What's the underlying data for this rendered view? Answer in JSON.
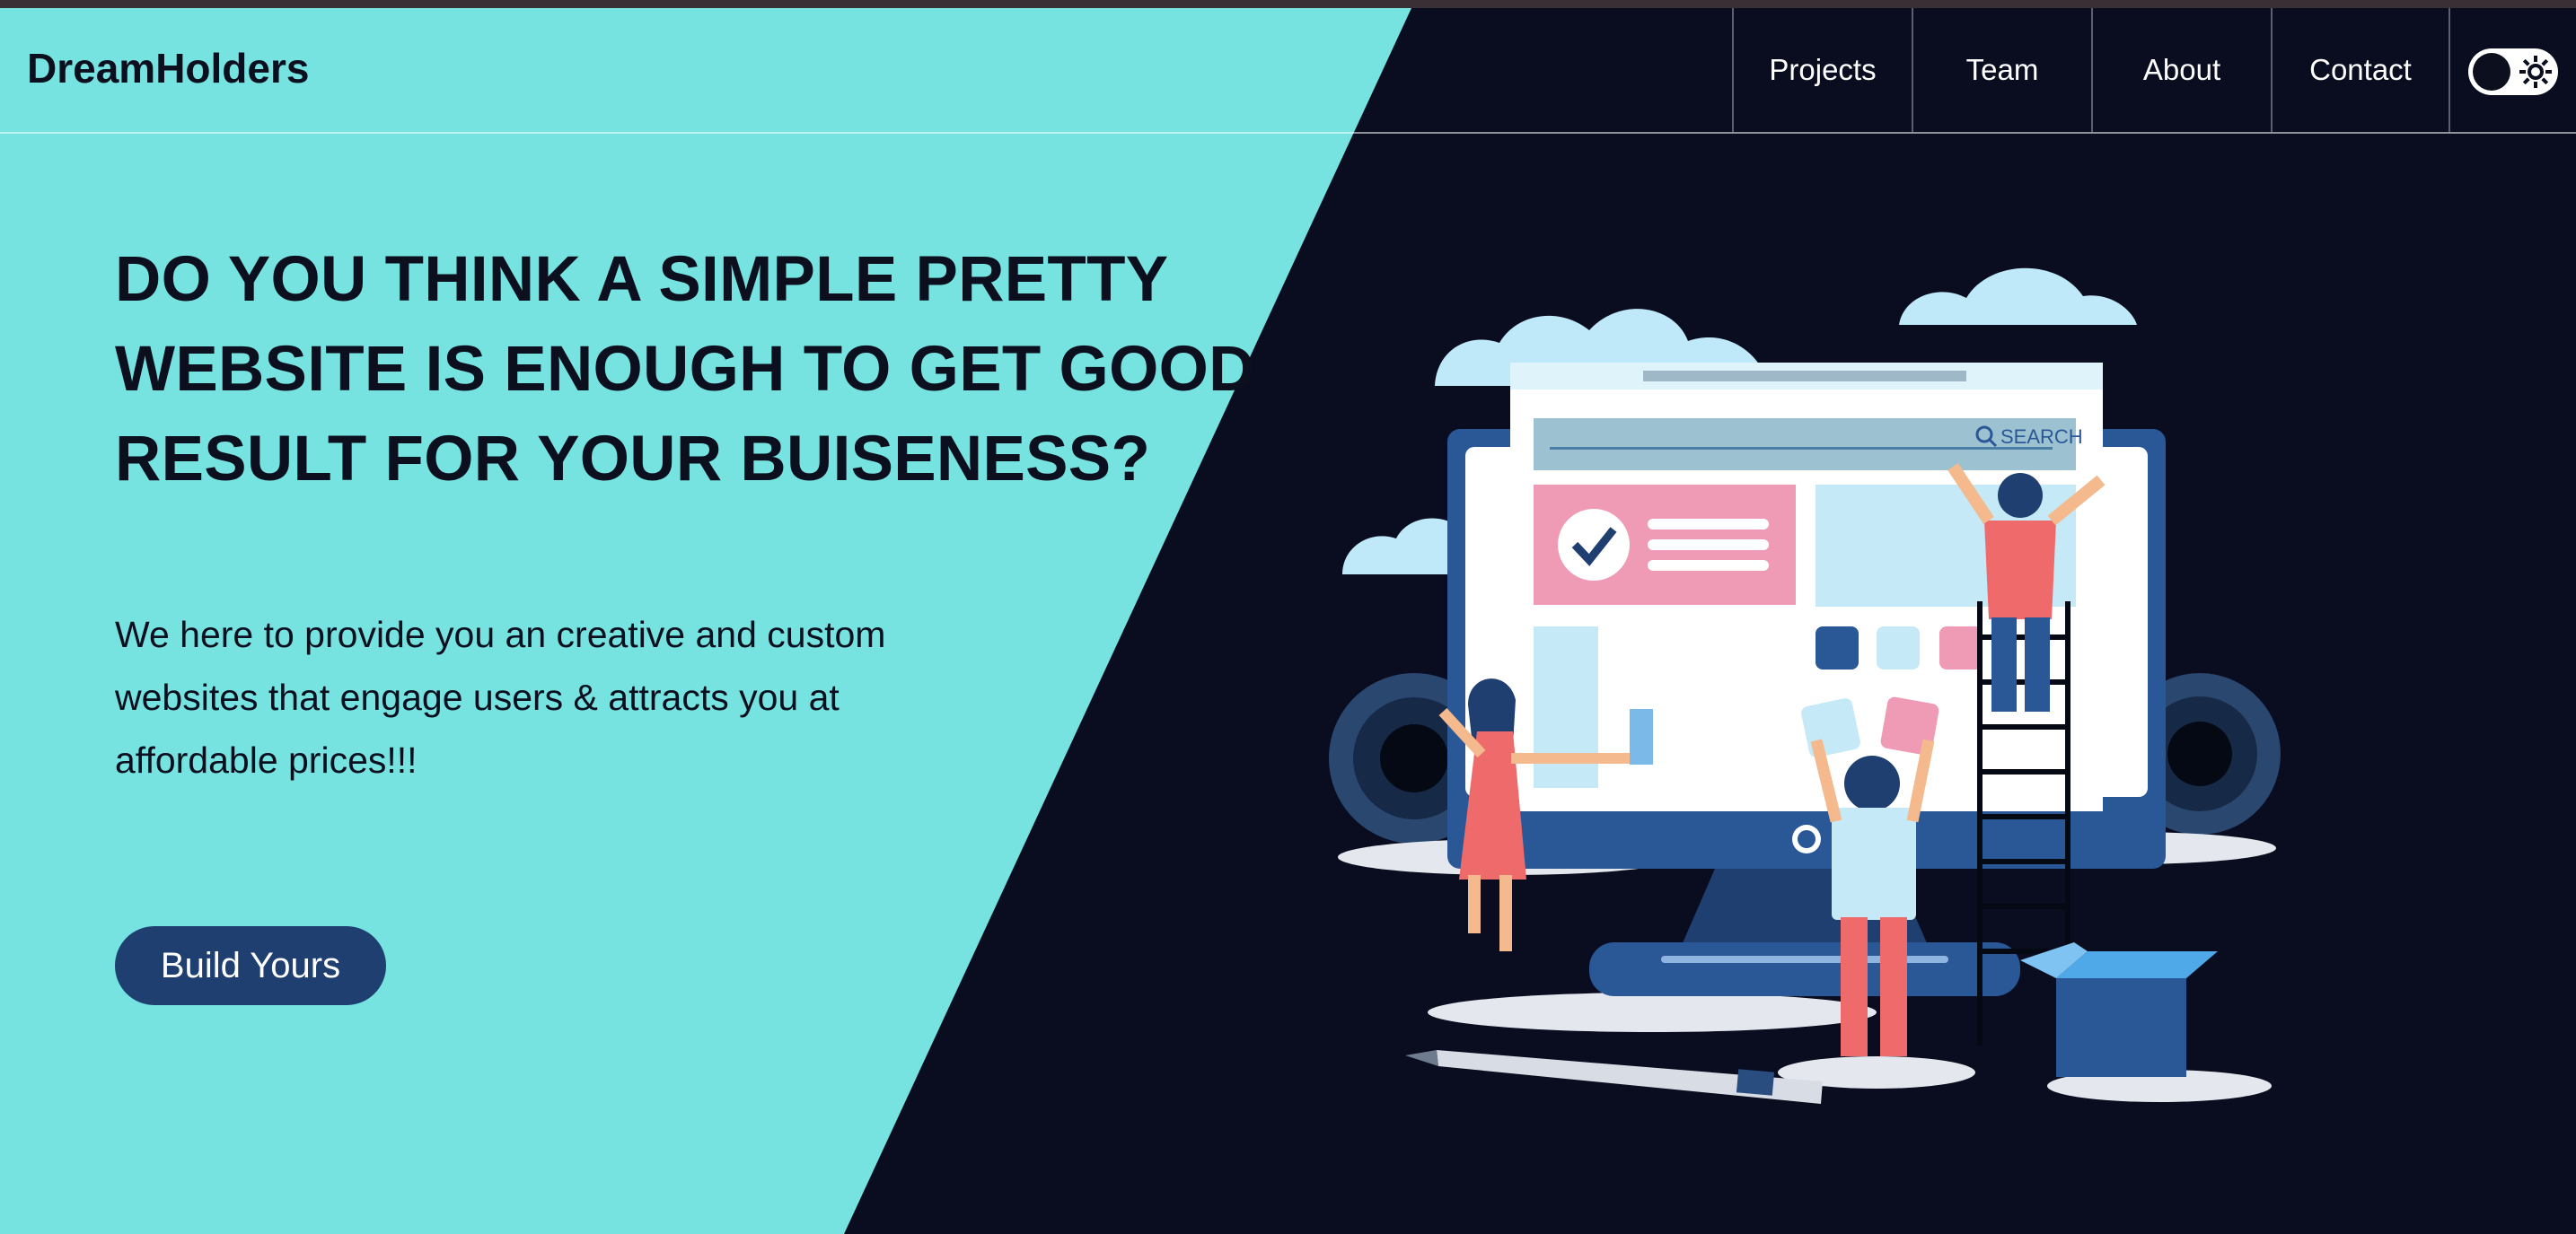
{
  "brand": "DreamHolders",
  "nav": {
    "items": [
      {
        "label": "Projects"
      },
      {
        "label": "Team"
      },
      {
        "label": "About"
      },
      {
        "label": "Contact"
      }
    ],
    "theme_toggle_icon": "sun-icon"
  },
  "hero": {
    "title_lines": [
      "DO YOU THINK A SIMPLE PRETTY",
      "WEBSITE IS ENOUGH TO GET GOOD",
      "RESULT FOR YOUR BUISENESS?"
    ],
    "text_lines": [
      "We here to provide you an creative and custom",
      "websites that engage users & attracts you at",
      "affordable prices!!!"
    ],
    "cta_label": "Build Yours"
  },
  "illustration": {
    "search_label": "SEARCH"
  },
  "colors": {
    "accent_cyan": "#76e3e1",
    "dark_bg": "#090d1f",
    "button": "#1e3f6f"
  }
}
